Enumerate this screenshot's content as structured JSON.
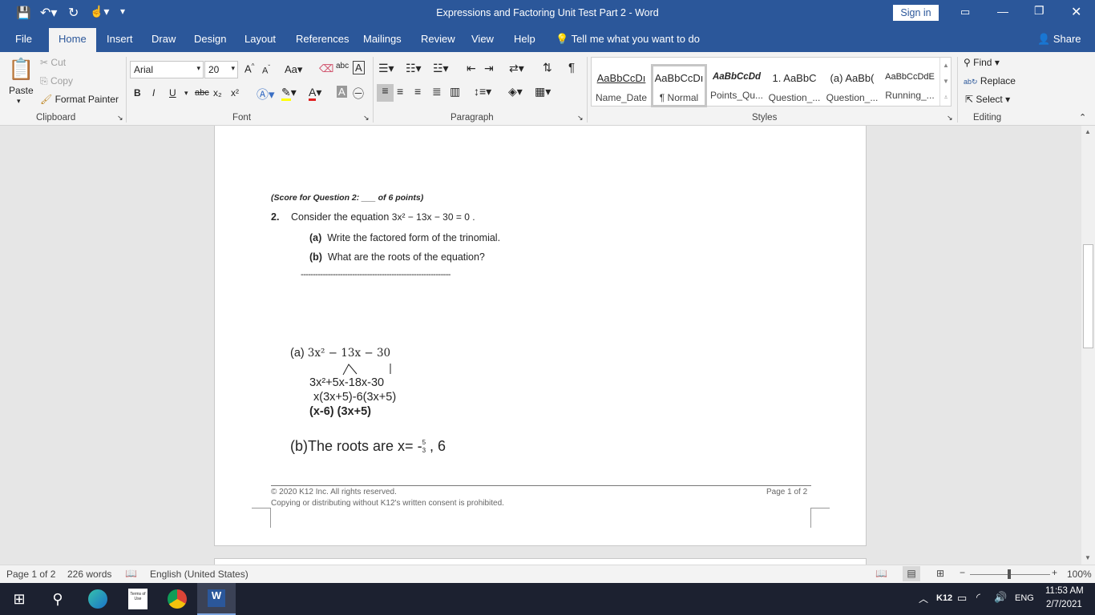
{
  "titlebar": {
    "title": "Expressions and Factoring Unit Test Part 2  -  Word",
    "sign_in": "Sign in"
  },
  "tabs": [
    "File",
    "Home",
    "Insert",
    "Draw",
    "Design",
    "Layout",
    "References",
    "Mailings",
    "Review",
    "View",
    "Help"
  ],
  "tell_me": "Tell me what you want to do",
  "share": "Share",
  "clipboard": {
    "paste": "Paste",
    "cut": "Cut",
    "copy": "Copy",
    "format_painter": "Format Painter",
    "label": "Clipboard"
  },
  "font": {
    "name": "Arial",
    "size": "20",
    "label": "Font",
    "bold": "B",
    "italic": "I",
    "underline": "U",
    "strike": "abc",
    "sub": "x₂",
    "sup": "x²"
  },
  "paragraph": {
    "label": "Paragraph"
  },
  "styles": {
    "label": "Styles",
    "items": [
      {
        "preview": "AaBbCcDı",
        "name": "Name_Date"
      },
      {
        "preview": "AaBbCcDı",
        "name": "¶ Normal"
      },
      {
        "preview": "AaBbCcDd",
        "name": "Points_Qu..."
      },
      {
        "preview": "1.  AaBbC",
        "name": "Question_..."
      },
      {
        "preview": "(a)  AaBb(",
        "name": "Question_..."
      },
      {
        "preview": "AaBbCcDdE",
        "name": "Running_..."
      }
    ]
  },
  "editing": {
    "label": "Editing",
    "find": "Find",
    "replace": "Replace",
    "select": "Select"
  },
  "document": {
    "score": "(Score for Question 2: ___ of 6 points)",
    "q_num": "2.",
    "q_text": "Consider the equation",
    "equation": "3x² − 13x − 30 = 0 .",
    "a_label": "(a)",
    "a_text": "Write the factored form of the trinomial.",
    "b_label": "(b)",
    "b_text": "What are the roots of the equation?",
    "dashes": "-------------------------------------------------------------",
    "ans_a_label": "(a)",
    "ans_a_expr": "3x² − 13x − 30",
    "step1": "3x²+5x-18x-30",
    "step2": "x(3x+5)-6(3x+5)",
    "step3": "(x-6) (3x+5)",
    "ans_b": "(b)The roots are x= -",
    "frac_num": "5",
    "frac_den": "3",
    "ans_b_end": ", 6",
    "footer_left1": "© 2020 K12 Inc. All rights reserved.",
    "footer_left2": "Copying or distributing without K12's written consent is prohibited.",
    "footer_right": "Page 1 of 2"
  },
  "status": {
    "page": "Page 1 of 2",
    "words": "226 words",
    "language": "English (United States)",
    "zoom": "100%"
  },
  "taskbar": {
    "keyboard": "K12",
    "lang": "ENG",
    "time": "11:53 AM",
    "date": "2/7/2021"
  }
}
